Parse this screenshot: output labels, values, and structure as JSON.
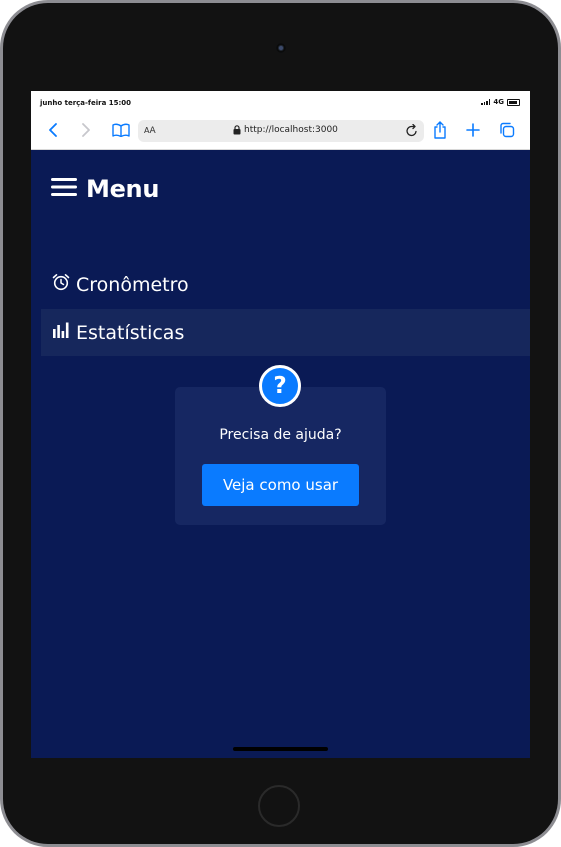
{
  "status_bar": {
    "time": "junho terça-feira 15:00",
    "network": "4G"
  },
  "browser": {
    "text_size_label_small": "A",
    "text_size_label_large": "A",
    "url": "http://localhost:3000",
    "accent_color": "#0a7bff"
  },
  "app": {
    "background_color": "#0a1a55",
    "menu_title": "Menu",
    "nav": [
      {
        "label": "Cronômetro",
        "icon": "alarm-clock-icon",
        "active": false
      },
      {
        "label": "Estatísticas",
        "icon": "bar-chart-icon",
        "active": true
      }
    ],
    "help": {
      "icon": "question-mark-icon",
      "text": "Precisa de ajuda?",
      "button_label": "Veja como usar",
      "button_color": "#0a7bff"
    }
  }
}
